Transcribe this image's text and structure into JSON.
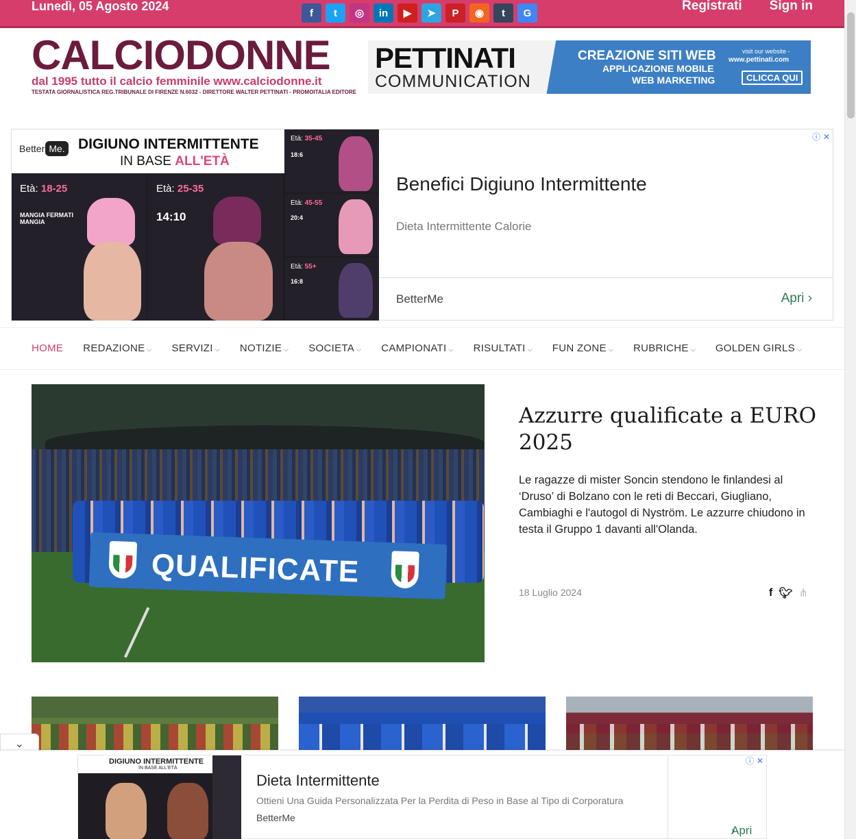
{
  "topbar": {
    "date": "Lunedì, 05 Agosto 2024",
    "social": [
      {
        "icon": "facebook-icon",
        "glyph": "f",
        "color": "#3b5998"
      },
      {
        "icon": "twitter-icon",
        "glyph": "t",
        "color": "#1da1f2"
      },
      {
        "icon": "instagram-icon",
        "glyph": "◎",
        "color": "#c13584"
      },
      {
        "icon": "linkedin-icon",
        "glyph": "in",
        "color": "#0077b5"
      },
      {
        "icon": "youtube-icon",
        "glyph": "▶",
        "color": "#cd201f"
      },
      {
        "icon": "telegram-icon",
        "glyph": "➤",
        "color": "#2ca5e0"
      },
      {
        "icon": "pinterest-icon",
        "glyph": "P",
        "color": "#cb2027"
      },
      {
        "icon": "rss-icon",
        "glyph": "◉",
        "color": "#f26522"
      },
      {
        "icon": "tumblr-icon",
        "glyph": "t",
        "color": "#35465c"
      },
      {
        "icon": "google-business-icon",
        "glyph": "G",
        "color": "#4285f4"
      }
    ],
    "register": "Registrati",
    "signin": "Sign in"
  },
  "logo": {
    "name": "CALCIODONNE",
    "tagline": "dal 1995 tutto il calcio femminile www.calciodonne.it",
    "subline": "TESTATA GIORNALISTICA REG.TRIBUNALE DI FIRENZE N.6032 - DIRETTORE WALTER PETTINATI - PROMOITALIA EDITORE"
  },
  "banner": {
    "brand": "PETTINATI",
    "brand_sub": "COMMUNICATION",
    "line1": "CREAZIONE SITI WEB",
    "line2": "APPLICAZIONE MOBILE",
    "line3": "WEB MARKETING",
    "visit": "visit our website -",
    "url": "www.pettinati.com",
    "cta": "CLICCA QUI"
  },
  "ad_top": {
    "brand_logo": "Better",
    "brand_logo_me": "Me.",
    "img_title": "DIGIUNO INTERMITTENTE",
    "img_sub_pre": "IN BASE",
    "img_sub_accent": "ALL'ETÀ",
    "panels": [
      {
        "age_label": "Età:",
        "age": "18-25",
        "plan": "MANGIA FERMATI MANGIA"
      },
      {
        "age_label": "Età:",
        "age": "25-35",
        "plan": "14:10"
      },
      {
        "age_label": "Età:",
        "age": "35-45",
        "plan": "18:6"
      },
      {
        "age_label": "Età:",
        "age": "45-55",
        "plan": "20:4"
      },
      {
        "age_label": "Età:",
        "age": "55+",
        "plan": "16:8"
      }
    ],
    "headline": "Benefici Digiuno Intermittente",
    "subline": "Dieta Intermittente Calorie",
    "advertiser": "BetterMe",
    "cta": "Apri"
  },
  "nav": {
    "items": [
      {
        "label": "HOME",
        "active": true
      },
      {
        "label": "REDAZIONE"
      },
      {
        "label": "SERVIZI"
      },
      {
        "label": "NOTIZIE"
      },
      {
        "label": "SOCIETA"
      },
      {
        "label": "CAMPIONATI"
      },
      {
        "label": "RISULTATI"
      },
      {
        "label": "FUN ZONE"
      },
      {
        "label": "RUBRICHE"
      },
      {
        "label": "GOLDEN GIRLS"
      }
    ]
  },
  "hero": {
    "banner_text": "QUALIFICATE",
    "title": "Azzurre qualificate a EURO 2025",
    "text": "Le ragazze di mister Soncin stendono le finlandesi al ‘Druso’ di Bolzano con le reti di Beccari, Giugliano, Cambiaghi e l'autogol di Nyström. Le azzurre chiudono in testa il Gruppo 1 davanti all'Olanda.",
    "date": "18 Luglio 2024"
  },
  "ad_bottom": {
    "img_title": "DIGIUNO INTERMITTENTE",
    "img_sub": "IN BASE ALL'ETÀ",
    "headline": "Dieta Intermittente",
    "subline": "Ottieni Una Guida Personalizzata Per la Perdita di Peso in Base al Tipo di Corporatura",
    "advertiser": "BetterMe",
    "cta": "Apri"
  }
}
